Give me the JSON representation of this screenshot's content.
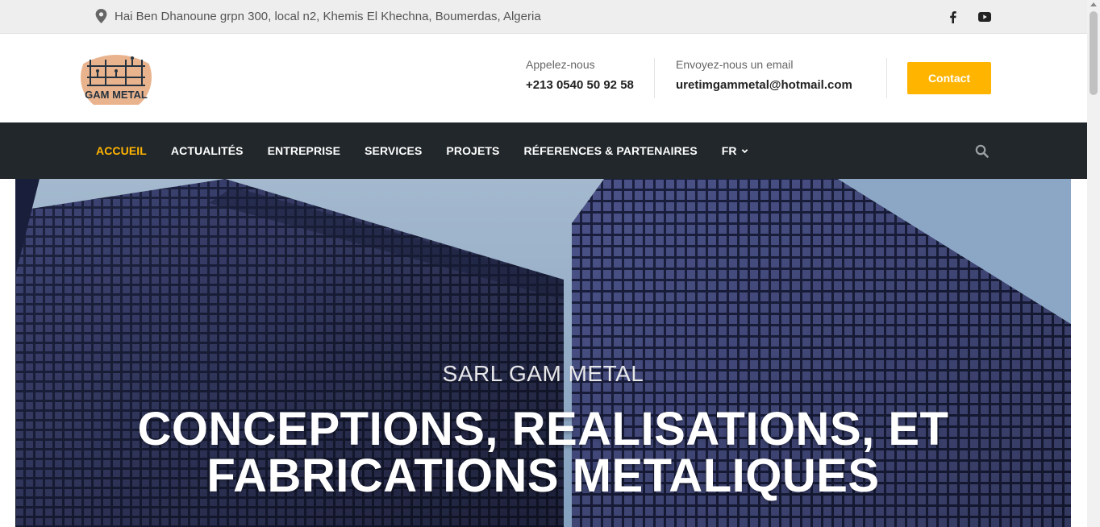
{
  "topbar": {
    "address": "Hai Ben Dhanoune grpn 300, local n2, Khemis El Khechna, Boumerdas, Algeria",
    "icons": [
      "map-pin-icon",
      "facebook-icon",
      "youtube-icon"
    ]
  },
  "header": {
    "logo_text": "GAM METAL",
    "phone_label": "Appelez-nous",
    "phone": "+213 0540 50 92 58",
    "email_label": "Envoyez-nous un email",
    "email": "uretimgammetal@hotmail.com",
    "contact_button": "Contact"
  },
  "nav": {
    "items": [
      {
        "label": "ACCUEIL",
        "active": true
      },
      {
        "label": "ACTUALITÉS",
        "active": false
      },
      {
        "label": "ENTREPRISE",
        "active": false
      },
      {
        "label": "SERVICES",
        "active": false
      },
      {
        "label": "PROJETS",
        "active": false
      },
      {
        "label": "RÉFERENCES & PARTENAIRES",
        "active": false
      },
      {
        "label": "FR",
        "active": false
      }
    ],
    "search_icon": "search-icon"
  },
  "hero": {
    "kicker": "SARL GAM METAL",
    "headline_line1": "CONCEPTIONS, REALISATIONS, ET",
    "headline_line2": "FABRICATIONS METALIQUES"
  },
  "colors": {
    "accent": "#ffb400",
    "nav_bg": "#22272b",
    "topbar_bg": "#eeeeee"
  }
}
